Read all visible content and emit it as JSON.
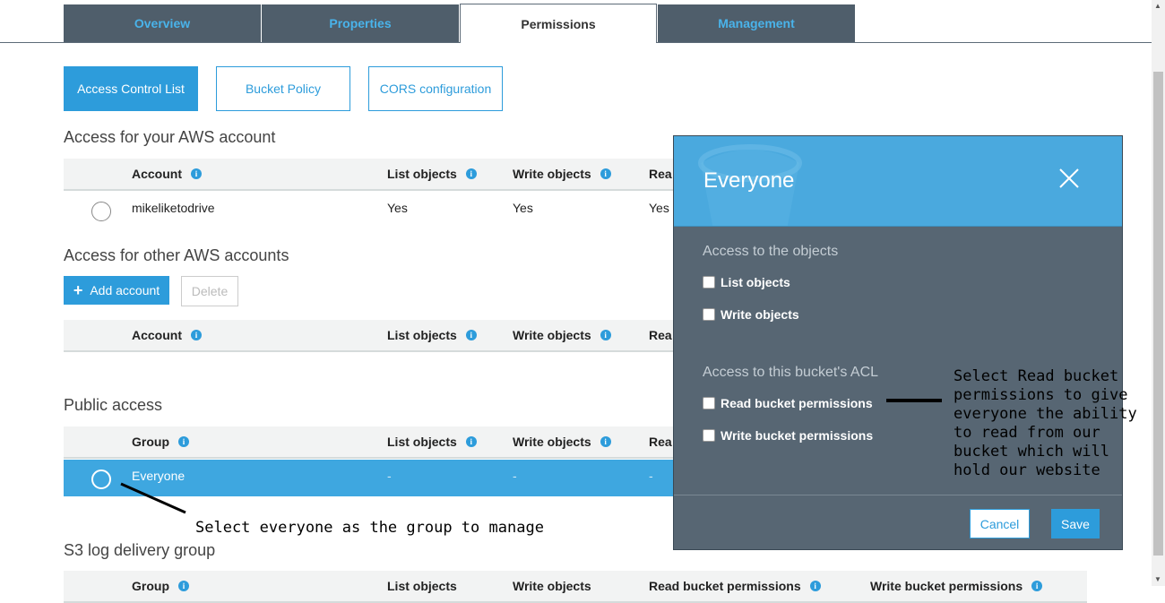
{
  "tabs": [
    "Overview",
    "Properties",
    "Permissions",
    "Management"
  ],
  "subtabs": [
    "Access Control List",
    "Bucket Policy",
    "CORS configuration"
  ],
  "own_account": {
    "title": "Access for your AWS account",
    "headers": {
      "account": "Account",
      "list": "List objects",
      "write": "Write objects",
      "read": "Rea"
    },
    "row": {
      "account": "mikeliketodrive",
      "list": "Yes",
      "write": "Yes",
      "read": "Yes"
    }
  },
  "other_accounts": {
    "title": "Access for other AWS accounts",
    "add_label": "Add account",
    "delete_label": "Delete",
    "headers": {
      "account": "Account",
      "list": "List objects",
      "write": "Write objects",
      "read": "Rea"
    }
  },
  "public_access": {
    "title": "Public access",
    "headers": {
      "group": "Group",
      "list": "List objects",
      "write": "Write objects",
      "read": "Rea"
    },
    "row": {
      "group": "Everyone",
      "list": "-",
      "write": "-",
      "read": "-"
    }
  },
  "log_delivery": {
    "title": "S3 log delivery group",
    "headers": {
      "group": "Group",
      "list": "List objects",
      "write": "Write objects",
      "read": "Read bucket permissions",
      "write_bucket": "Write bucket permissions"
    }
  },
  "modal": {
    "title": "Everyone",
    "objects_heading": "Access to the objects",
    "list_objects": "List objects",
    "write_objects": "Write objects",
    "acl_heading": "Access to this bucket's ACL",
    "read_bucket": "Read bucket permissions",
    "write_bucket": "Write bucket permissions",
    "cancel": "Cancel",
    "save": "Save"
  },
  "annotations": {
    "select_everyone": "Select everyone as the group to manage",
    "read_note": [
      "Select Read bucket",
      "permissions to give",
      "everyone the ability",
      "to read from our",
      "bucket which will",
      "hold our website"
    ]
  },
  "colors": {
    "accent": "#2d9cdb",
    "tab_bg": "#4f5e6b",
    "modal_bg": "#576673",
    "modal_header": "#4aa9de"
  }
}
